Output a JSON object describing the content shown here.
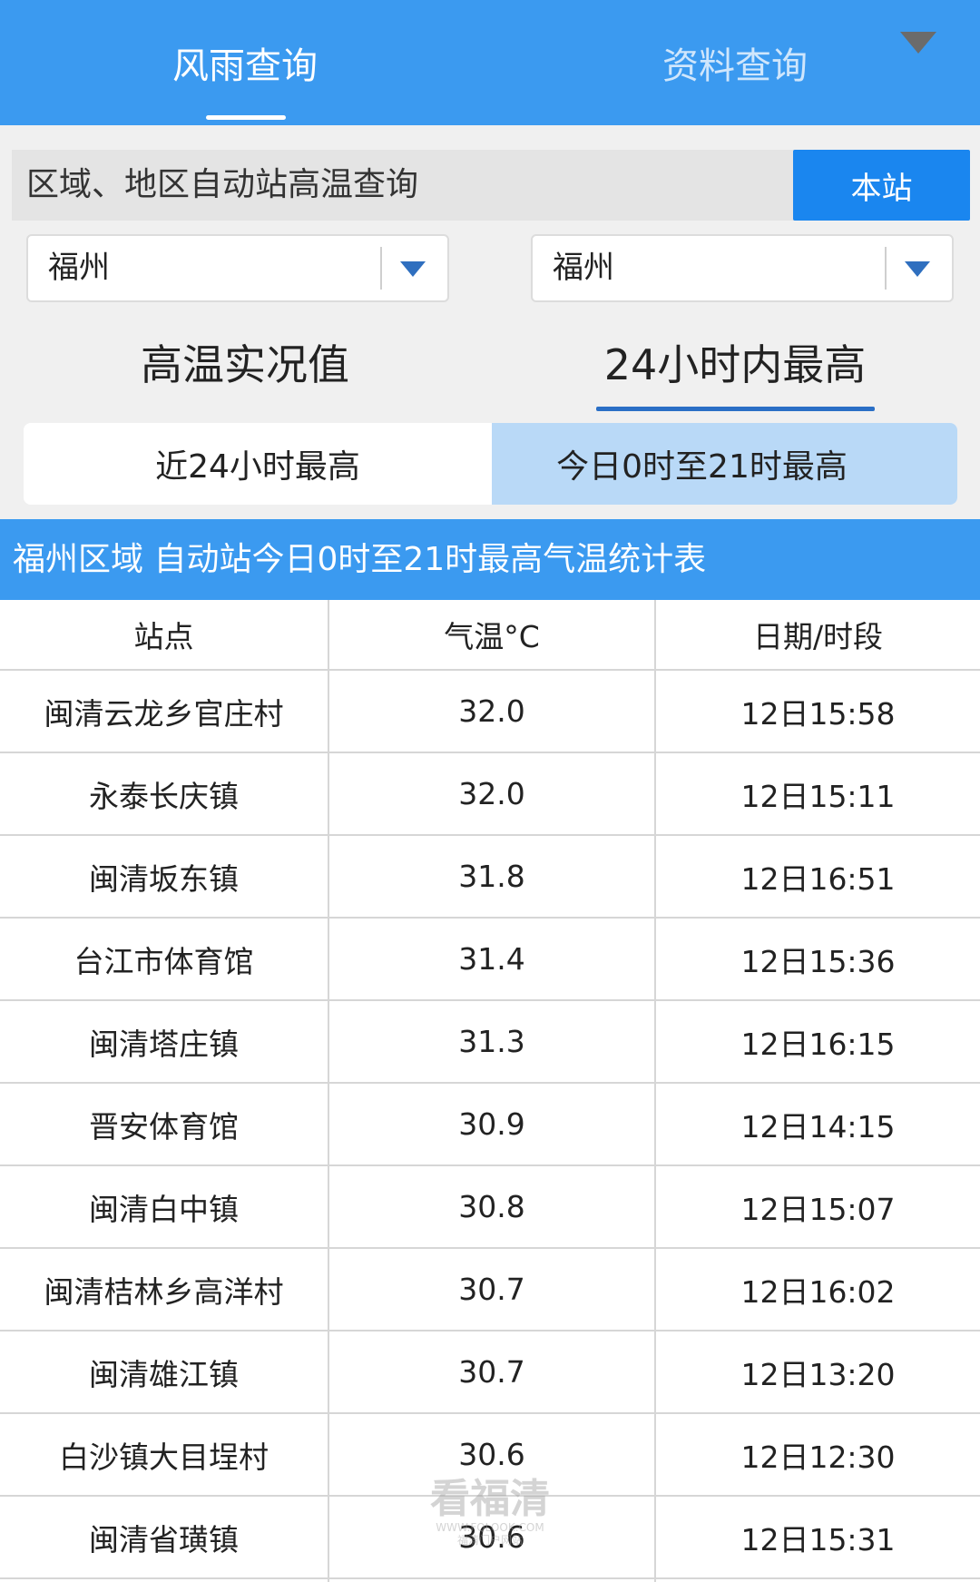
{
  "top_tabs": [
    {
      "label": "风雨查询",
      "active": true
    },
    {
      "label": "资料查询",
      "active": false
    }
  ],
  "query": {
    "label": "区域、地区自动站高温查询",
    "station_button": "本站"
  },
  "selects": [
    {
      "value": "福州"
    },
    {
      "value": "福州"
    }
  ],
  "mode_tabs": [
    {
      "label": "高温实况值",
      "active": false
    },
    {
      "label": "24小时内最高",
      "active": true
    }
  ],
  "range_options": [
    {
      "label": "近24小时最高",
      "selected": false
    },
    {
      "label": "今日0时至21时最高",
      "selected": true
    }
  ],
  "table_title": "福州区域 自动站今日0时至21时最高气温统计表",
  "table": {
    "headers": [
      "站点",
      "气温°C",
      "日期/时段"
    ],
    "rows": [
      [
        "闽清云龙乡官庄村",
        "32.0",
        "12日15:58"
      ],
      [
        "永泰长庆镇",
        "32.0",
        "12日15:11"
      ],
      [
        "闽清坂东镇",
        "31.8",
        "12日16:51"
      ],
      [
        "台江市体育馆",
        "31.4",
        "12日15:36"
      ],
      [
        "闽清塔庄镇",
        "31.3",
        "12日16:15"
      ],
      [
        "晋安体育馆",
        "30.9",
        "12日14:15"
      ],
      [
        "闽清白中镇",
        "30.8",
        "12日15:07"
      ],
      [
        "闽清桔林乡高洋村",
        "30.7",
        "12日16:02"
      ],
      [
        "闽清雄江镇",
        "30.7",
        "12日13:20"
      ],
      [
        "白沙镇大目埕村",
        "30.6",
        "12日12:30"
      ],
      [
        "闽清省璜镇",
        "30.6",
        "12日15:31"
      ]
    ]
  },
  "watermark": {
    "main": "看福清",
    "sub1": "WWW.FQLOOK.COM",
    "sub2": "福清门户网站"
  },
  "colors": {
    "header_blue": "#3b9af0",
    "button_blue": "#1a86ef",
    "selected_option_bg": "#b9d9f7",
    "tab_underline": "#2a6fc6"
  }
}
